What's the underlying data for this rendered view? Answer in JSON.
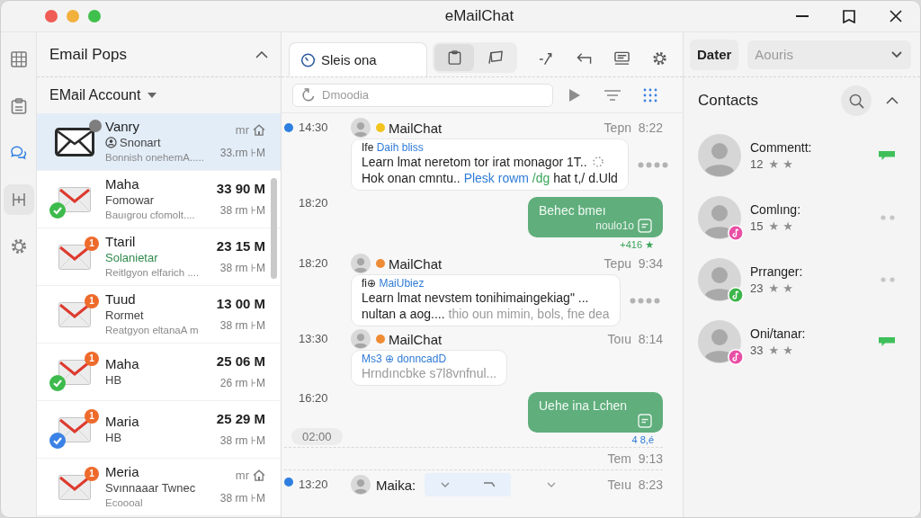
{
  "window": {
    "title": "eMailChat"
  },
  "rail": [
    {
      "kind": "grid",
      "selected": false,
      "hovered": false
    },
    {
      "kind": "clipboard",
      "selected": false,
      "hovered": false
    },
    {
      "kind": "chat",
      "selected": true,
      "hovered": false
    },
    {
      "kind": "columns",
      "selected": false,
      "hovered": true
    },
    {
      "kind": "gear",
      "selected": false,
      "hovered": false
    }
  ],
  "mail_panel": {
    "title": "Email Pops",
    "account": "EMail Account",
    "emails": [
      {
        "kind": "outline",
        "name": "Vanry",
        "subject": "Snonart",
        "preview": "Bonnish onehemA.....",
        "time": "mr",
        "age": "33.rm ⊦M",
        "selected": true,
        "unread": false,
        "status_dot": true,
        "subject_icon": true,
        "home_icon": true,
        "subject_highlight": false
      },
      {
        "kind": "red",
        "name": "Maha",
        "subject": "Fomowar",
        "preview": "Bauıgrou cfomolt....",
        "time": "33 90 M",
        "age": "38 rm ⊦M",
        "selected": false,
        "unread": true,
        "status_dot": false,
        "subject_icon": false,
        "home_icon": false,
        "subject_highlight": false,
        "app_badge": {
          "color": "#3dbb4c"
        }
      },
      {
        "kind": "red",
        "name": "Ttaril",
        "subject": "Solanietar",
        "preview": "Reitlgyon elfarich ....",
        "time": "23 15 M",
        "age": "38 rm ⊦M",
        "selected": false,
        "unread": true,
        "status_dot": false,
        "subject_icon": false,
        "home_icon": false,
        "subject_highlight": true,
        "count": "1"
      },
      {
        "kind": "red",
        "name": "Tuud",
        "subject": "Rormet",
        "preview": "Reatgyon eltanaA m",
        "time": "13 00 M",
        "age": "38 rm ⊦M",
        "selected": false,
        "unread": true,
        "status_dot": false,
        "subject_icon": false,
        "home_icon": false,
        "subject_highlight": false,
        "count": "1"
      },
      {
        "kind": "red",
        "name": "Maha",
        "subject": "HB",
        "time": "25 06 M",
        "age": "26 rm ⊦M",
        "selected": false,
        "unread": true,
        "status_dot": false,
        "subject_icon": false,
        "home_icon": false,
        "subject_highlight": false,
        "count": "1",
        "app_badge": {
          "color": "#3dbb4c"
        }
      },
      {
        "kind": "red",
        "name": "Maria",
        "subject": "HB",
        "time": "25 29 M",
        "age": "38 rm ⊦M",
        "selected": false,
        "unread": true,
        "status_dot": false,
        "subject_icon": false,
        "home_icon": false,
        "subject_highlight": false,
        "count": "1",
        "app_badge": {
          "color": "#3b82e6"
        }
      },
      {
        "kind": "red",
        "name": "Meria",
        "subject": "Svınnaaar Twnec",
        "preview": "Ecoooal",
        "time": "mr",
        "age": "38 rm ⊦M",
        "selected": false,
        "unread": false,
        "status_dot": false,
        "subject_icon": false,
        "home_icon": true,
        "subject_highlight": false,
        "count": "1"
      }
    ]
  },
  "chat_panel": {
    "tabs": [
      {
        "label": "Sleis ona",
        "selected": true
      }
    ],
    "toolbar": [
      {
        "kind": "clipboard",
        "selected": true
      },
      {
        "kind": "flag",
        "selected": false
      }
    ],
    "search": {
      "placeholder": "Dmoodia"
    },
    "messages": [
      {
        "kind": "incoming",
        "unread": true,
        "time": "14:30",
        "sender": "MailChat",
        "color": "#f2c41c",
        "stamp": "Tepn  8:22",
        "heading": [
          {
            "kind": "plain",
            "text": "Ife "
          },
          {
            "kind": "link",
            "text": "Daih bliss"
          }
        ],
        "lines": [
          [
            {
              "kind": "plain",
              "text": "Learn lmat neretom tor irat monagor 1T.."
            }
          ],
          [
            {
              "kind": "plain",
              "text": "Hok onan cmntu.. "
            },
            {
              "kind": "link",
              "text": "Plesk rowm"
            },
            {
              "kind": "green",
              "text": " /dg"
            },
            {
              "kind": "plain",
              "text": " hat t,/ d.Uld"
            }
          ]
        ],
        "pending": true,
        "more": true
      },
      {
        "kind": "outgoing",
        "time": "18:20",
        "text": "Behec bmeı",
        "note": "noulo1o",
        "receipt": "+416 ★",
        "read": true
      },
      {
        "kind": "incoming",
        "unread": false,
        "time": "18:20",
        "sender": "MailChat",
        "color": "#ef8b35",
        "stamp": "Tepu  9:34",
        "heading": [
          {
            "kind": "plain",
            "text": "fi⊕ "
          },
          {
            "kind": "link",
            "text": "MaiUbiez"
          }
        ],
        "lines": [
          [
            {
              "kind": "plain",
              "text": "Learn lmat nevstem tonihimaingekiag\" ..."
            }
          ],
          [
            {
              "kind": "plain",
              "text": "nultan a aog...."
            },
            {
              "kind": "muted",
              "text": " thio oun mimin, bols, fne dea"
            }
          ]
        ],
        "pending": false,
        "more": true
      },
      {
        "kind": "incoming",
        "unread": false,
        "time": "13:30",
        "sender": "MailChat",
        "color": "#ef8b35",
        "stamp": "Toıu  8:14",
        "heading": [
          {
            "kind": "link",
            "text": "Ms3 ⊕ donncadD"
          }
        ],
        "lines": [
          [
            {
              "kind": "muted",
              "text": "Hrndıncbke s7l8vnfnul..."
            }
          ]
        ],
        "pending": false,
        "more": false
      },
      {
        "kind": "outgoing",
        "time": "16:20",
        "text": "Uehe ina Lchen",
        "receipt": "4 8,é",
        "read": false
      },
      {
        "kind": "divider",
        "time": "02:00",
        "stamp": "Tem  9:13"
      },
      {
        "kind": "collapsed",
        "unread": true,
        "time": "13:20",
        "sender": "Maika:",
        "stamp": "Teıu  8:23"
      }
    ]
  },
  "contacts_panel": {
    "filter": "Dater",
    "dropdown": {
      "value": "Aouris"
    },
    "title": "Contacts",
    "contacts": [
      {
        "kind": "chat",
        "name": "Commentt:",
        "count": "12",
        "marks": "★ ★"
      },
      {
        "kind": "more",
        "name": "Comlıng:",
        "count": "15",
        "marks": "★ ★",
        "color": "#e84fa5"
      },
      {
        "kind": "more",
        "name": "Prranger:",
        "count": "23",
        "marks": "★ ★",
        "color": "#3cb54a"
      },
      {
        "kind": "chat",
        "name": "Oni/tanar:",
        "count": "33",
        "marks": "★ ★",
        "color": "#e84fa5"
      }
    ]
  }
}
